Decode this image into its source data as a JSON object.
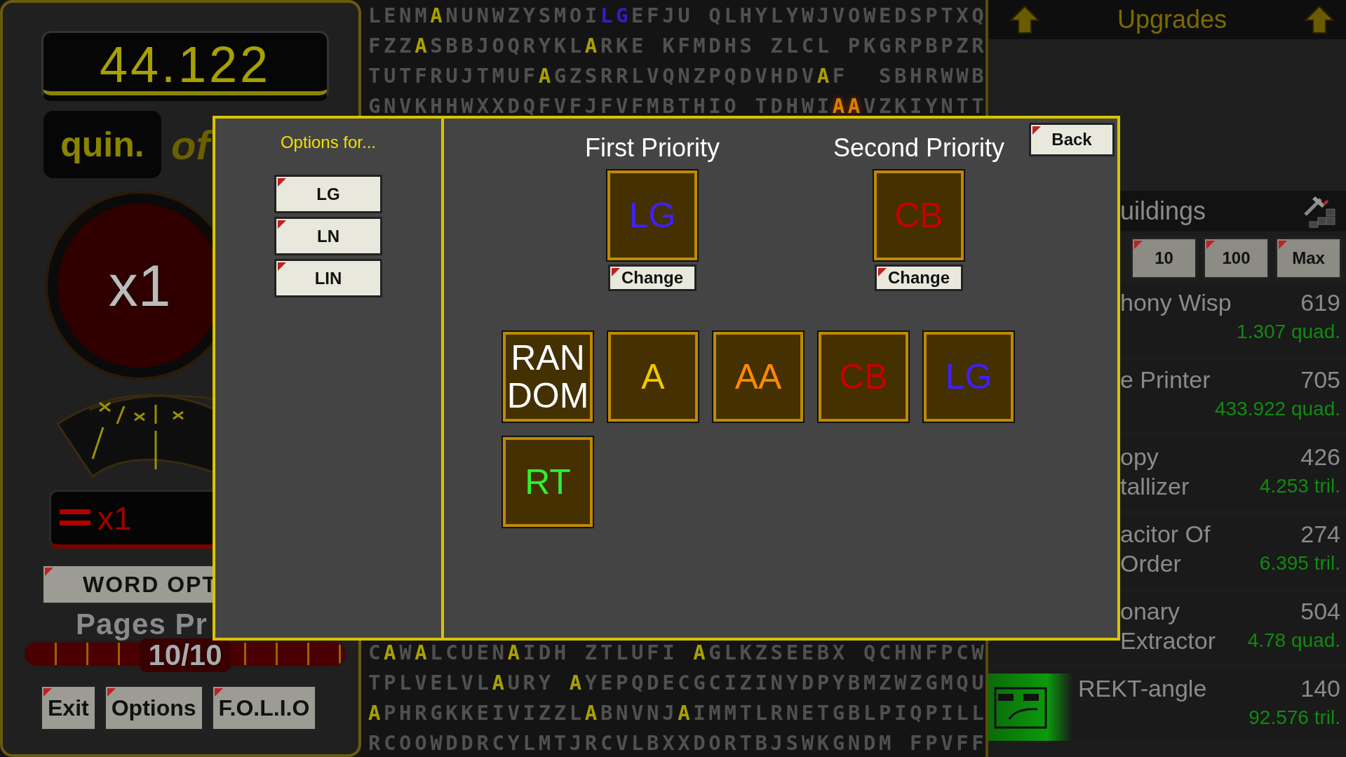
{
  "left_panel": {
    "counter": {
      "value": "44.122",
      "unit": "quin.",
      "caption": "of"
    },
    "multiplier_button": "x1",
    "multiplier_field": "x1",
    "word_options_button": "WORD OPT",
    "pages": {
      "label": "Pages Pr",
      "reading": "10/10",
      "level": 1
    },
    "buttons": [
      "Exit",
      "Options",
      "F.O.L.I.O"
    ]
  },
  "letter_grid": {
    "top_rows": [
      [
        {
          "text": "LENM",
          "kind": "plain"
        },
        {
          "text": "A",
          "kind": "a"
        },
        {
          "text": "NUNWZYSMOI",
          "kind": "plain"
        },
        {
          "text": "LG",
          "kind": "lg"
        },
        {
          "text": "EFJU QLHYLYWJVOWEDSPTXQ",
          "kind": "plain"
        }
      ],
      [
        {
          "text": "FZZ",
          "kind": "plain"
        },
        {
          "text": "A",
          "kind": "a"
        },
        {
          "text": "SBBJOQRYKL",
          "kind": "plain"
        },
        {
          "text": "A",
          "kind": "a"
        },
        {
          "text": "RKE KFMDHS ZLCL PKGRPBPZR",
          "kind": "plain"
        }
      ],
      [
        {
          "text": "TUTFRUJTMUF",
          "kind": "plain"
        },
        {
          "text": "A",
          "kind": "a"
        },
        {
          "text": "GZSRRLVQNZPQDVHDV",
          "kind": "plain"
        },
        {
          "text": "A",
          "kind": "a"
        },
        {
          "text": "F  SBHRWWB",
          "kind": "plain"
        }
      ],
      [
        {
          "text": "GNVKHHWXXDQFVFJFVFMBTHIO TDHWI",
          "kind": "plain"
        },
        {
          "text": "AA",
          "kind": "aa"
        },
        {
          "text": "VZKIYNTT",
          "kind": "plain"
        }
      ]
    ],
    "bottom_rows": [
      [
        {
          "text": "C",
          "kind": "plain"
        },
        {
          "text": "A",
          "kind": "a"
        },
        {
          "text": "W",
          "kind": "plain"
        },
        {
          "text": "A",
          "kind": "a"
        },
        {
          "text": "LCUEN",
          "kind": "plain"
        },
        {
          "text": "A",
          "kind": "a"
        },
        {
          "text": "IDH ZTLUFI ",
          "kind": "plain"
        },
        {
          "text": "A",
          "kind": "a"
        },
        {
          "text": "GLKZSEEBX QCHNFPCW",
          "kind": "plain"
        }
      ],
      [
        {
          "text": "TPLVELVL",
          "kind": "plain"
        },
        {
          "text": "A",
          "kind": "a"
        },
        {
          "text": "URY ",
          "kind": "plain"
        },
        {
          "text": "A",
          "kind": "a"
        },
        {
          "text": "YEPQDECGCIZINYDPYBMZWZGMQU",
          "kind": "plain"
        }
      ],
      [
        {
          "text": "A",
          "kind": "a"
        },
        {
          "text": "PHRGKKEIVIZZL",
          "kind": "plain"
        },
        {
          "text": "A",
          "kind": "a"
        },
        {
          "text": "BNVNJ",
          "kind": "plain"
        },
        {
          "text": "A",
          "kind": "a"
        },
        {
          "text": "IMMTLRNETGBLPIQPILL",
          "kind": "plain"
        }
      ],
      [
        {
          "text": "RCOOWDDRCYLMTJRCVLBXXDORTBJSWKGNDM FPVFF",
          "kind": "plain"
        }
      ]
    ]
  },
  "upgrades": {
    "title": "Upgrades"
  },
  "buildings": {
    "title": "uildings",
    "amount_buttons": [
      "10",
      "100",
      "Max"
    ],
    "items": [
      {
        "name_lines": [
          "hony Wisp"
        ],
        "count": "619",
        "cost": "1.307 quad.",
        "picture": false
      },
      {
        "name_lines": [
          "e Printer"
        ],
        "count": "705",
        "cost": "433.922 quad.",
        "picture": false
      },
      {
        "name_lines": [
          "opy",
          "tallizer"
        ],
        "count": "426",
        "cost": "4.253 tril.",
        "picture": false
      },
      {
        "name_lines": [
          "acitor Of",
          "Order"
        ],
        "count": "274",
        "cost": "6.395 tril.",
        "picture": false
      },
      {
        "name_lines": [
          "onary",
          "Extractor"
        ],
        "count": "504",
        "cost": "4.78 quad.",
        "picture": false
      },
      {
        "name_lines": [
          "REKT-angle"
        ],
        "count": "140",
        "cost": "92.576 tril.",
        "picture": true
      }
    ]
  },
  "dialog": {
    "heading": "Options for...",
    "words": [
      "LG",
      "LN",
      "LIN"
    ],
    "back_button": "Back",
    "priorities": [
      {
        "title": "First Priority",
        "tile": {
          "label": "LG",
          "kind": "lg"
        },
        "button": "Change"
      },
      {
        "title": "Second Priority",
        "tile": {
          "label": "CB",
          "kind": "cb"
        },
        "button": "Change"
      }
    ],
    "options": [
      {
        "label": "RANDOM",
        "kind": "random"
      },
      {
        "label": "A",
        "kind": "a"
      },
      {
        "label": "AA",
        "kind": "aa"
      },
      {
        "label": "CB",
        "kind": "cb"
      },
      {
        "label": "LG",
        "kind": "lg"
      },
      {
        "label": "RT",
        "kind": "rt"
      }
    ]
  }
}
